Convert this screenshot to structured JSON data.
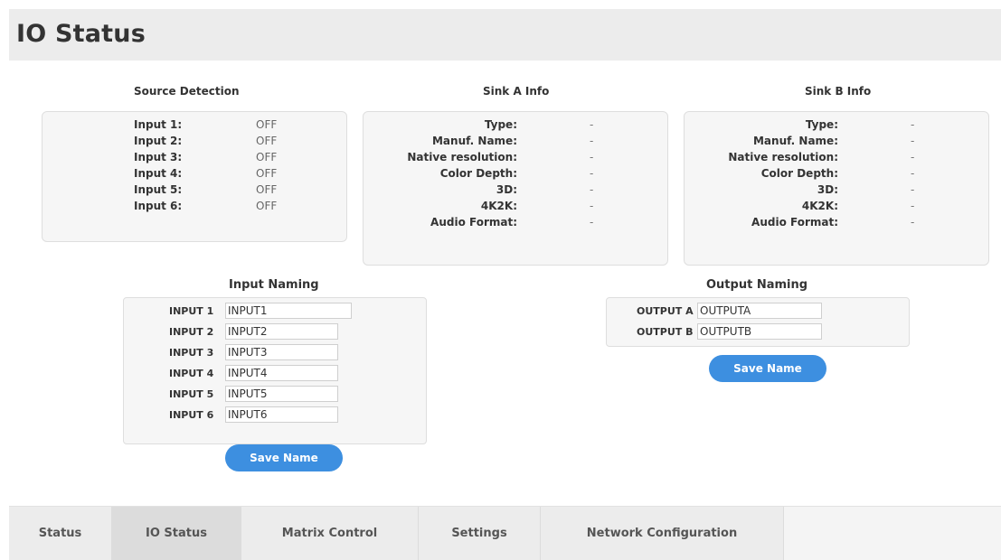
{
  "header": {
    "title": "IO Status"
  },
  "source_detection": {
    "title": "Source Detection",
    "inputs": [
      {
        "label": "Input 1:",
        "value": "OFF"
      },
      {
        "label": "Input 2:",
        "value": "OFF"
      },
      {
        "label": "Input 3:",
        "value": "OFF"
      },
      {
        "label": "Input 4:",
        "value": "OFF"
      },
      {
        "label": "Input 5:",
        "value": "OFF"
      },
      {
        "label": "Input 6:",
        "value": "OFF"
      }
    ]
  },
  "sink_a": {
    "title": "Sink A Info",
    "fields": [
      {
        "label": "Type:",
        "value": "-"
      },
      {
        "label": "Manuf. Name:",
        "value": "-"
      },
      {
        "label": "Native resolution:",
        "value": "-"
      },
      {
        "label": "Color Depth:",
        "value": "-"
      },
      {
        "label": "3D:",
        "value": "-"
      },
      {
        "label": "4K2K:",
        "value": "-"
      },
      {
        "label": "Audio Format:",
        "value": "-"
      }
    ]
  },
  "sink_b": {
    "title": "Sink B Info",
    "fields": [
      {
        "label": "Type:",
        "value": "-"
      },
      {
        "label": "Manuf. Name:",
        "value": "-"
      },
      {
        "label": "Native resolution:",
        "value": "-"
      },
      {
        "label": "Color Depth:",
        "value": "-"
      },
      {
        "label": "3D:",
        "value": "-"
      },
      {
        "label": "4K2K:",
        "value": "-"
      },
      {
        "label": "Audio Format:",
        "value": "-"
      }
    ]
  },
  "input_naming": {
    "title": "Input Naming",
    "rows": [
      {
        "label": "INPUT 1",
        "value": "INPUT1"
      },
      {
        "label": "INPUT 2",
        "value": "INPUT2"
      },
      {
        "label": "INPUT 3",
        "value": "INPUT3"
      },
      {
        "label": "INPUT 4",
        "value": "INPUT4"
      },
      {
        "label": "INPUT 5",
        "value": "INPUT5"
      },
      {
        "label": "INPUT 6",
        "value": "INPUT6"
      }
    ],
    "save_label": "Save Name"
  },
  "output_naming": {
    "title": "Output Naming",
    "rows": [
      {
        "label": "OUTPUT A",
        "value": "OUTPUTA"
      },
      {
        "label": "OUTPUT B",
        "value": "OUTPUTB"
      }
    ],
    "save_label": "Save Name"
  },
  "tabs": [
    {
      "label": "Status"
    },
    {
      "label": "IO Status"
    },
    {
      "label": "Matrix Control"
    },
    {
      "label": "Settings"
    },
    {
      "label": "Network Configuration"
    }
  ],
  "colors": {
    "accent": "#3d8fe0",
    "active_tab": "#dcdcdc"
  }
}
